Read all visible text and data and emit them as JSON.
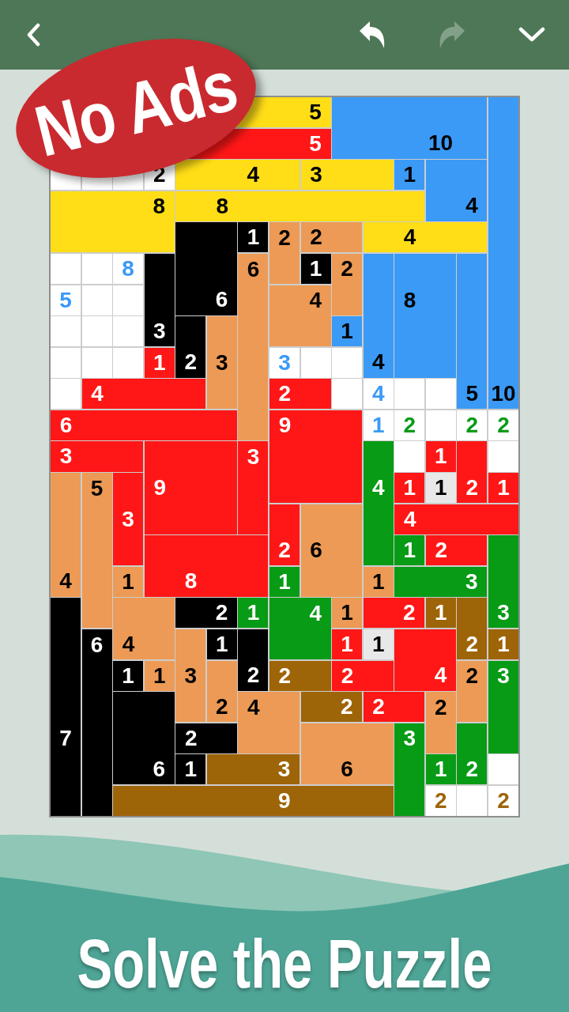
{
  "toolbar": {
    "buttons": [
      {
        "kind": "back",
        "disabled": false
      },
      {
        "kind": "undo",
        "disabled": false
      },
      {
        "kind": "redo",
        "disabled": true
      },
      {
        "kind": "dropdown",
        "disabled": false
      }
    ]
  },
  "badge": {
    "text": "No Ads"
  },
  "grid": {
    "rows": [
      [
        {
          "kind": "hidden"
        },
        {
          "kind": "hidden"
        },
        {
          "kind": "hidden"
        },
        {
          "kind": "hidden"
        },
        {
          "kind": "start",
          "color": "#ffdd17"
        },
        {
          "kind": "joinleft"
        },
        {
          "kind": "joinleft"
        },
        {
          "kind": "joinleft"
        },
        {
          "kind": "joinleft",
          "clue": {
            "text": "5"
          }
        },
        {
          "kind": "start",
          "color": "#3a9af6"
        },
        {
          "kind": "joinleft"
        },
        {
          "kind": "joinleft"
        },
        {
          "kind": "joinleft"
        },
        {
          "kind": "joinleft"
        },
        {
          "kind": "start",
          "color": "#3a9af6"
        }
      ],
      [
        {
          "kind": "hidden"
        },
        {
          "kind": "hidden"
        },
        {
          "kind": "hidden"
        },
        {
          "kind": "hidden"
        },
        {
          "kind": "start",
          "color": "#ff1717"
        },
        {
          "kind": "joinleft"
        },
        {
          "kind": "joinleft"
        },
        {
          "kind": "joinleft"
        },
        {
          "kind": "joinleft",
          "clue": {
            "text": "5"
          }
        },
        {
          "kind": "joinup"
        },
        {
          "kind": "joinup"
        },
        {
          "kind": "joinup"
        },
        {
          "kind": "joinup",
          "clue": {
            "text": "10"
          }
        },
        {
          "kind": "joinup"
        },
        {
          "kind": "joinup"
        }
      ],
      [
        {
          "kind": "start",
          "color": "#ffffff"
        },
        {
          "kind": "start",
          "color": "#ffffff"
        },
        {
          "kind": "start",
          "color": "#ffffff"
        },
        {
          "kind": "start",
          "color": "#ffffff",
          "clue": {
            "text": "2",
            "color": "#000000"
          }
        },
        {
          "kind": "start",
          "color": "#ffdd17"
        },
        {
          "kind": "joinleft"
        },
        {
          "kind": "joinleft",
          "clue": {
            "text": "4"
          }
        },
        {
          "kind": "joinleft"
        },
        {
          "kind": "start",
          "color": "#ffdd17",
          "clue": {
            "text": "3"
          }
        },
        {
          "kind": "joinleft"
        },
        {
          "kind": "joinleft"
        },
        {
          "kind": "start",
          "color": "#3a9af6",
          "clue": {
            "text": "1"
          }
        },
        {
          "kind": "start",
          "color": "#3a9af6"
        },
        {
          "kind": "joinleft"
        },
        {
          "kind": "joinup"
        }
      ],
      [
        {
          "kind": "start",
          "color": "#ffdd17"
        },
        {
          "kind": "joinleft"
        },
        {
          "kind": "joinleft"
        },
        {
          "kind": "joinleft",
          "clue": {
            "text": "8"
          }
        },
        {
          "kind": "start",
          "color": "#ffdd17"
        },
        {
          "kind": "joinleft",
          "clue": {
            "text": "8"
          }
        },
        {
          "kind": "joinleft"
        },
        {
          "kind": "joinleft"
        },
        {
          "kind": "joinleft"
        },
        {
          "kind": "joinleft"
        },
        {
          "kind": "joinleft"
        },
        {
          "kind": "joinleft"
        },
        {
          "kind": "joinup"
        },
        {
          "kind": "joinup",
          "clue": {
            "text": "4"
          }
        },
        {
          "kind": "joinup"
        }
      ],
      [
        {
          "kind": "joinup"
        },
        {
          "kind": "joinup"
        },
        {
          "kind": "joinup"
        },
        {
          "kind": "joinup"
        },
        {
          "kind": "start",
          "color": "#000000"
        },
        {
          "kind": "joinleft"
        },
        {
          "kind": "start",
          "color": "#000000",
          "clue": {
            "text": "1"
          }
        },
        {
          "kind": "start",
          "color": "#ec9a55",
          "clue": {
            "text": "2"
          }
        },
        {
          "kind": "start",
          "color": "#ec9a55",
          "clue": {
            "text": "2"
          }
        },
        {
          "kind": "joinleft"
        },
        {
          "kind": "start",
          "color": "#ffdd17"
        },
        {
          "kind": "joinleft",
          "clue": {
            "text": "4"
          }
        },
        {
          "kind": "joinleft"
        },
        {
          "kind": "joinleft"
        },
        {
          "kind": "joinup"
        }
      ],
      [
        {
          "kind": "start",
          "color": "#ffffff"
        },
        {
          "kind": "start",
          "color": "#ffffff"
        },
        {
          "kind": "start",
          "color": "#ffffff",
          "clue": {
            "text": "8",
            "color": "#3a9af6"
          }
        },
        {
          "kind": "start",
          "color": "#000000"
        },
        {
          "kind": "joinup"
        },
        {
          "kind": "joinup"
        },
        {
          "kind": "start",
          "color": "#ec9a55",
          "clue": {
            "text": "6"
          }
        },
        {
          "kind": "joinup"
        },
        {
          "kind": "start",
          "color": "#000000",
          "clue": {
            "text": "1"
          }
        },
        {
          "kind": "start",
          "color": "#ec9a55",
          "clue": {
            "text": "2"
          }
        },
        {
          "kind": "start",
          "color": "#3a9af6"
        },
        {
          "kind": "start",
          "color": "#3a9af6"
        },
        {
          "kind": "joinleft"
        },
        {
          "kind": "start",
          "color": "#3a9af6"
        },
        {
          "kind": "joinup"
        }
      ],
      [
        {
          "kind": "start",
          "color": "#ffffff",
          "clue": {
            "text": "5",
            "color": "#3a9af6"
          }
        },
        {
          "kind": "start",
          "color": "#ffffff"
        },
        {
          "kind": "start",
          "color": "#ffffff"
        },
        {
          "kind": "joinup"
        },
        {
          "kind": "joinup"
        },
        {
          "kind": "joinup",
          "clue": {
            "text": "6"
          }
        },
        {
          "kind": "joinup"
        },
        {
          "kind": "start",
          "color": "#ec9a55"
        },
        {
          "kind": "joinleft",
          "clue": {
            "text": "4"
          }
        },
        {
          "kind": "joinup"
        },
        {
          "kind": "joinup"
        },
        {
          "kind": "joinup",
          "clue": {
            "text": "8"
          }
        },
        {
          "kind": "joinup"
        },
        {
          "kind": "joinup"
        },
        {
          "kind": "joinup"
        }
      ],
      [
        {
          "kind": "start",
          "color": "#ffffff"
        },
        {
          "kind": "start",
          "color": "#ffffff"
        },
        {
          "kind": "start",
          "color": "#ffffff"
        },
        {
          "kind": "joinup",
          "clue": {
            "text": "3"
          }
        },
        {
          "kind": "start",
          "color": "#000000"
        },
        {
          "kind": "start",
          "color": "#ec9a55"
        },
        {
          "kind": "joinup"
        },
        {
          "kind": "joinup"
        },
        {
          "kind": "joinup"
        },
        {
          "kind": "start",
          "color": "#3a9af6",
          "clue": {
            "text": "1"
          }
        },
        {
          "kind": "joinup"
        },
        {
          "kind": "joinup"
        },
        {
          "kind": "joinup"
        },
        {
          "kind": "joinup"
        },
        {
          "kind": "joinup"
        }
      ],
      [
        {
          "kind": "start",
          "color": "#ffffff"
        },
        {
          "kind": "start",
          "color": "#ffffff"
        },
        {
          "kind": "start",
          "color": "#ffffff"
        },
        {
          "kind": "start",
          "color": "#ff1717",
          "clue": {
            "text": "1"
          }
        },
        {
          "kind": "joinup",
          "clue": {
            "text": "2"
          }
        },
        {
          "kind": "joinup",
          "clue": {
            "text": "3"
          }
        },
        {
          "kind": "joinup"
        },
        {
          "kind": "start",
          "color": "#ffffff",
          "clue": {
            "text": "3",
            "color": "#3a9af6"
          }
        },
        {
          "kind": "start",
          "color": "#ffffff"
        },
        {
          "kind": "start",
          "color": "#ffffff"
        },
        {
          "kind": "joinup",
          "clue": {
            "text": "4"
          }
        },
        {
          "kind": "joinup"
        },
        {
          "kind": "joinup"
        },
        {
          "kind": "joinup"
        },
        {
          "kind": "joinup"
        }
      ],
      [
        {
          "kind": "start",
          "color": "#ffffff"
        },
        {
          "kind": "start",
          "color": "#ff1717",
          "clue": {
            "text": "4"
          }
        },
        {
          "kind": "joinleft"
        },
        {
          "kind": "joinleft"
        },
        {
          "kind": "joinleft"
        },
        {
          "kind": "joinup"
        },
        {
          "kind": "joinup"
        },
        {
          "kind": "start",
          "color": "#ff1717",
          "clue": {
            "text": "2"
          }
        },
        {
          "kind": "joinleft"
        },
        {
          "kind": "start",
          "color": "#ffffff"
        },
        {
          "kind": "start",
          "color": "#ffffff",
          "clue": {
            "text": "4",
            "color": "#3a9af6"
          }
        },
        {
          "kind": "start",
          "color": "#ffffff"
        },
        {
          "kind": "start",
          "color": "#ffffff"
        },
        {
          "kind": "joinup",
          "clue": {
            "text": "5"
          }
        },
        {
          "kind": "joinup",
          "clue": {
            "text": "10"
          }
        }
      ],
      [
        {
          "kind": "start",
          "color": "#ff1717",
          "clue": {
            "text": "6"
          }
        },
        {
          "kind": "joinleft"
        },
        {
          "kind": "joinleft"
        },
        {
          "kind": "joinleft"
        },
        {
          "kind": "joinleft"
        },
        {
          "kind": "joinleft"
        },
        {
          "kind": "joinup"
        },
        {
          "kind": "start",
          "color": "#ff1717",
          "clue": {
            "text": "9"
          }
        },
        {
          "kind": "joinleft"
        },
        {
          "kind": "joinleft"
        },
        {
          "kind": "start",
          "color": "#ffffff",
          "clue": {
            "text": "1",
            "color": "#3a9af6"
          }
        },
        {
          "kind": "start",
          "color": "#ffffff",
          "clue": {
            "text": "2",
            "color": "#079b16"
          }
        },
        {
          "kind": "start",
          "color": "#ffffff"
        },
        {
          "kind": "start",
          "color": "#ffffff",
          "clue": {
            "text": "2",
            "color": "#079b16"
          }
        },
        {
          "kind": "start",
          "color": "#ffffff",
          "clue": {
            "text": "2",
            "color": "#079b16"
          }
        }
      ],
      [
        {
          "kind": "start",
          "color": "#ff1717",
          "clue": {
            "text": "3"
          }
        },
        {
          "kind": "joinleft"
        },
        {
          "kind": "joinleft"
        },
        {
          "kind": "start",
          "color": "#ff1717"
        },
        {
          "kind": "joinleft"
        },
        {
          "kind": "joinleft"
        },
        {
          "kind": "start",
          "color": "#ff1717",
          "clue": {
            "text": "3"
          }
        },
        {
          "kind": "joinup"
        },
        {
          "kind": "joinup"
        },
        {
          "kind": "joinup"
        },
        {
          "kind": "start",
          "color": "#079b16"
        },
        {
          "kind": "start",
          "color": "#ffffff"
        },
        {
          "kind": "start",
          "color": "#ff1717",
          "clue": {
            "text": "1"
          }
        },
        {
          "kind": "start",
          "color": "#ff1717"
        },
        {
          "kind": "start",
          "color": "#ffffff"
        }
      ],
      [
        {
          "kind": "start",
          "color": "#ec9a55"
        },
        {
          "kind": "start",
          "color": "#ec9a55",
          "clue": {
            "text": "5"
          }
        },
        {
          "kind": "start",
          "color": "#ff1717"
        },
        {
          "kind": "joinup",
          "clue": {
            "text": "9"
          }
        },
        {
          "kind": "joinup"
        },
        {
          "kind": "joinup"
        },
        {
          "kind": "joinup"
        },
        {
          "kind": "joinup"
        },
        {
          "kind": "joinup"
        },
        {
          "kind": "joinup"
        },
        {
          "kind": "joinup",
          "clue": {
            "text": "4"
          }
        },
        {
          "kind": "start",
          "color": "#ff1717",
          "clue": {
            "text": "1"
          }
        },
        {
          "kind": "start",
          "color": "#e8e8e8",
          "clue": {
            "text": "1"
          }
        },
        {
          "kind": "joinup",
          "clue": {
            "text": "2"
          }
        },
        {
          "kind": "start",
          "color": "#ff1717",
          "clue": {
            "text": "1"
          }
        }
      ],
      [
        {
          "kind": "joinup"
        },
        {
          "kind": "joinup"
        },
        {
          "kind": "joinup",
          "clue": {
            "text": "3"
          }
        },
        {
          "kind": "joinup"
        },
        {
          "kind": "joinup"
        },
        {
          "kind": "joinup"
        },
        {
          "kind": "joinup"
        },
        {
          "kind": "start",
          "color": "#ff1717"
        },
        {
          "kind": "start",
          "color": "#ec9a55"
        },
        {
          "kind": "joinleft"
        },
        {
          "kind": "joinup"
        },
        {
          "kind": "start",
          "color": "#ff1717",
          "clue": {
            "text": "4"
          }
        },
        {
          "kind": "joinleft"
        },
        {
          "kind": "joinleft"
        },
        {
          "kind": "joinleft"
        }
      ],
      [
        {
          "kind": "joinup"
        },
        {
          "kind": "joinup"
        },
        {
          "kind": "joinup"
        },
        {
          "kind": "start",
          "color": "#ff1717"
        },
        {
          "kind": "joinleft"
        },
        {
          "kind": "joinleft"
        },
        {
          "kind": "joinleft"
        },
        {
          "kind": "joinup",
          "clue": {
            "text": "2"
          }
        },
        {
          "kind": "joinup",
          "clue": {
            "text": "6"
          }
        },
        {
          "kind": "joinup"
        },
        {
          "kind": "joinup"
        },
        {
          "kind": "start",
          "color": "#079b16",
          "clue": {
            "text": "1"
          }
        },
        {
          "kind": "start",
          "color": "#ff1717",
          "clue": {
            "text": "2"
          }
        },
        {
          "kind": "joinleft"
        },
        {
          "kind": "start",
          "color": "#079b16"
        }
      ],
      [
        {
          "kind": "joinup",
          "clue": {
            "text": "4"
          }
        },
        {
          "kind": "joinup"
        },
        {
          "kind": "start",
          "color": "#ec9a55",
          "clue": {
            "text": "1"
          }
        },
        {
          "kind": "joinup"
        },
        {
          "kind": "joinup",
          "clue": {
            "text": "8"
          }
        },
        {
          "kind": "joinup"
        },
        {
          "kind": "joinup"
        },
        {
          "kind": "start",
          "color": "#079b16",
          "clue": {
            "text": "1"
          }
        },
        {
          "kind": "joinup"
        },
        {
          "kind": "joinup"
        },
        {
          "kind": "start",
          "color": "#ec9a55",
          "clue": {
            "text": "1"
          }
        },
        {
          "kind": "start",
          "color": "#079b16"
        },
        {
          "kind": "joinleft"
        },
        {
          "kind": "joinleft",
          "clue": {
            "text": "3"
          }
        },
        {
          "kind": "joinup"
        }
      ],
      [
        {
          "kind": "start",
          "color": "#000000"
        },
        {
          "kind": "joinup"
        },
        {
          "kind": "start",
          "color": "#ec9a55"
        },
        {
          "kind": "joinleft"
        },
        {
          "kind": "start",
          "color": "#000000"
        },
        {
          "kind": "joinleft",
          "clue": {
            "text": "2"
          }
        },
        {
          "kind": "start",
          "color": "#079b16",
          "clue": {
            "text": "1"
          }
        },
        {
          "kind": "start",
          "color": "#079b16"
        },
        {
          "kind": "joinleft",
          "clue": {
            "text": "4"
          }
        },
        {
          "kind": "start",
          "color": "#ec9a55",
          "clue": {
            "text": "1"
          }
        },
        {
          "kind": "start",
          "color": "#ff1717"
        },
        {
          "kind": "joinleft",
          "clue": {
            "text": "2"
          }
        },
        {
          "kind": "start",
          "color": "#9e6408",
          "clue": {
            "text": "1"
          }
        },
        {
          "kind": "start",
          "color": "#9e6408"
        },
        {
          "kind": "joinup",
          "clue": {
            "text": "3"
          }
        }
      ],
      [
        {
          "kind": "joinup"
        },
        {
          "kind": "start",
          "color": "#000000",
          "clue": {
            "text": "6"
          }
        },
        {
          "kind": "joinup",
          "clue": {
            "text": "4"
          }
        },
        {
          "kind": "joinup"
        },
        {
          "kind": "start",
          "color": "#ec9a55"
        },
        {
          "kind": "start",
          "color": "#000000",
          "clue": {
            "text": "1"
          }
        },
        {
          "kind": "start",
          "color": "#000000"
        },
        {
          "kind": "joinup"
        },
        {
          "kind": "joinup"
        },
        {
          "kind": "start",
          "color": "#ff1717",
          "clue": {
            "text": "1"
          }
        },
        {
          "kind": "start",
          "color": "#e8e8e8",
          "clue": {
            "text": "1"
          }
        },
        {
          "kind": "start",
          "color": "#ff1717"
        },
        {
          "kind": "joinleft"
        },
        {
          "kind": "joinup",
          "clue": {
            "text": "2"
          }
        },
        {
          "kind": "start",
          "color": "#9e6408",
          "clue": {
            "text": "1"
          }
        }
      ],
      [
        {
          "kind": "joinup"
        },
        {
          "kind": "joinup"
        },
        {
          "kind": "start",
          "color": "#000000",
          "clue": {
            "text": "1"
          }
        },
        {
          "kind": "start",
          "color": "#ec9a55",
          "clue": {
            "text": "1"
          }
        },
        {
          "kind": "joinup",
          "clue": {
            "text": "3"
          }
        },
        {
          "kind": "start",
          "color": "#ec9a55"
        },
        {
          "kind": "joinup",
          "clue": {
            "text": "2"
          }
        },
        {
          "kind": "start",
          "color": "#9e6408",
          "clue": {
            "text": "2"
          }
        },
        {
          "kind": "joinleft"
        },
        {
          "kind": "start",
          "color": "#ff1717",
          "clue": {
            "text": "2"
          }
        },
        {
          "kind": "joinleft"
        },
        {
          "kind": "joinup"
        },
        {
          "kind": "joinup",
          "clue": {
            "text": "4"
          }
        },
        {
          "kind": "start",
          "color": "#ec9a55",
          "clue": {
            "text": "2"
          }
        },
        {
          "kind": "start",
          "color": "#079b16",
          "clue": {
            "text": "3"
          }
        }
      ],
      [
        {
          "kind": "joinup"
        },
        {
          "kind": "joinup"
        },
        {
          "kind": "start",
          "color": "#000000"
        },
        {
          "kind": "joinleft"
        },
        {
          "kind": "joinup"
        },
        {
          "kind": "joinup",
          "clue": {
            "text": "2"
          }
        },
        {
          "kind": "start",
          "color": "#ec9a55",
          "clue": {
            "text": "4"
          }
        },
        {
          "kind": "joinleft"
        },
        {
          "kind": "start",
          "color": "#9e6408"
        },
        {
          "kind": "joinleft",
          "clue": {
            "text": "2"
          }
        },
        {
          "kind": "start",
          "color": "#ff1717",
          "clue": {
            "text": "2"
          }
        },
        {
          "kind": "joinleft"
        },
        {
          "kind": "start",
          "color": "#ec9a55",
          "clue": {
            "text": "2"
          }
        },
        {
          "kind": "joinup"
        },
        {
          "kind": "joinup"
        }
      ],
      [
        {
          "kind": "joinup",
          "clue": {
            "text": "7"
          }
        },
        {
          "kind": "joinup"
        },
        {
          "kind": "joinup"
        },
        {
          "kind": "joinup"
        },
        {
          "kind": "start",
          "color": "#000000",
          "clue": {
            "text": "2"
          }
        },
        {
          "kind": "joinleft"
        },
        {
          "kind": "joinup"
        },
        {
          "kind": "joinup"
        },
        {
          "kind": "start",
          "color": "#ec9a55"
        },
        {
          "kind": "joinleft"
        },
        {
          "kind": "joinleft"
        },
        {
          "kind": "start",
          "color": "#079b16",
          "clue": {
            "text": "3"
          }
        },
        {
          "kind": "joinup"
        },
        {
          "kind": "start",
          "color": "#079b16"
        },
        {
          "kind": "joinup"
        }
      ],
      [
        {
          "kind": "joinup"
        },
        {
          "kind": "joinup"
        },
        {
          "kind": "joinup"
        },
        {
          "kind": "joinup",
          "clue": {
            "text": "6"
          }
        },
        {
          "kind": "start",
          "color": "#000000",
          "clue": {
            "text": "1"
          }
        },
        {
          "kind": "start",
          "color": "#9e6408"
        },
        {
          "kind": "joinleft"
        },
        {
          "kind": "joinleft",
          "clue": {
            "text": "3"
          }
        },
        {
          "kind": "joinup"
        },
        {
          "kind": "joinup",
          "clue": {
            "text": "6"
          }
        },
        {
          "kind": "joinup"
        },
        {
          "kind": "joinup"
        },
        {
          "kind": "start",
          "color": "#079b16",
          "clue": {
            "text": "1"
          }
        },
        {
          "kind": "joinup",
          "clue": {
            "text": "2"
          }
        },
        {
          "kind": "start",
          "color": "#ffffff"
        }
      ],
      [
        {
          "kind": "joinup"
        },
        {
          "kind": "joinup"
        },
        {
          "kind": "start",
          "color": "#9e6408"
        },
        {
          "kind": "joinleft"
        },
        {
          "kind": "joinleft"
        },
        {
          "kind": "joinleft"
        },
        {
          "kind": "joinleft"
        },
        {
          "kind": "joinleft",
          "clue": {
            "text": "9"
          }
        },
        {
          "kind": "joinleft"
        },
        {
          "kind": "joinleft"
        },
        {
          "kind": "joinleft"
        },
        {
          "kind": "joinup"
        },
        {
          "kind": "start",
          "color": "#ffffff",
          "clue": {
            "text": "2",
            "color": "#9e6408"
          }
        },
        {
          "kind": "start",
          "color": "#ffffff"
        },
        {
          "kind": "start",
          "color": "#ffffff",
          "clue": {
            "text": "2",
            "color": "#9e6408"
          }
        }
      ]
    ]
  },
  "banner": {
    "text": "Solve the Puzzle"
  }
}
